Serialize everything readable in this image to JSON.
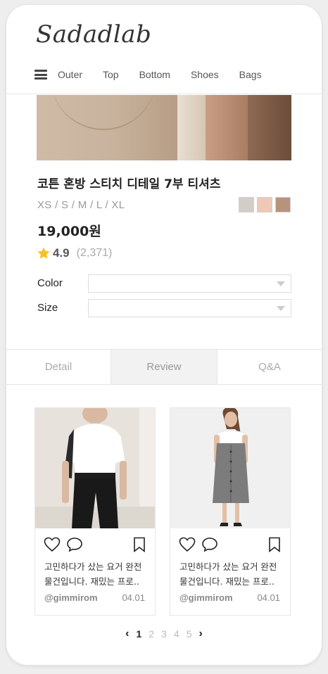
{
  "header": {
    "logo": "Sadadlab",
    "nav": [
      "Outer",
      "Top",
      "Bottom",
      "Shoes",
      "Bags"
    ]
  },
  "product": {
    "title": "코튼 혼방 스티치 디테일 7부 티셔츠",
    "sizes": "XS / S / M / L / XL",
    "swatches": [
      "#d2cdc6",
      "#f0c8b6",
      "#b8937c"
    ],
    "price": "19,000원",
    "rating": "4.9",
    "rating_count": "(2,371)",
    "star_color": "#f5c224"
  },
  "options": {
    "color_label": "Color",
    "size_label": "Size"
  },
  "tabs": [
    "Detail",
    "Review",
    "Q&A"
  ],
  "reviews": [
    {
      "text": "고민하다가 샀는 요거 완전 물건입니다. 재밌는 프로..",
      "user": "@gimmirom",
      "date": "04.01"
    },
    {
      "text": "고민하다가 샀는 요거 완전 물건입니다. 재밌는 프로..",
      "user": "@gimmirom",
      "date": "04.01"
    }
  ],
  "pagination": {
    "prev": "‹",
    "pages": [
      "1",
      "2",
      "3",
      "4",
      "5"
    ],
    "next": "›"
  }
}
